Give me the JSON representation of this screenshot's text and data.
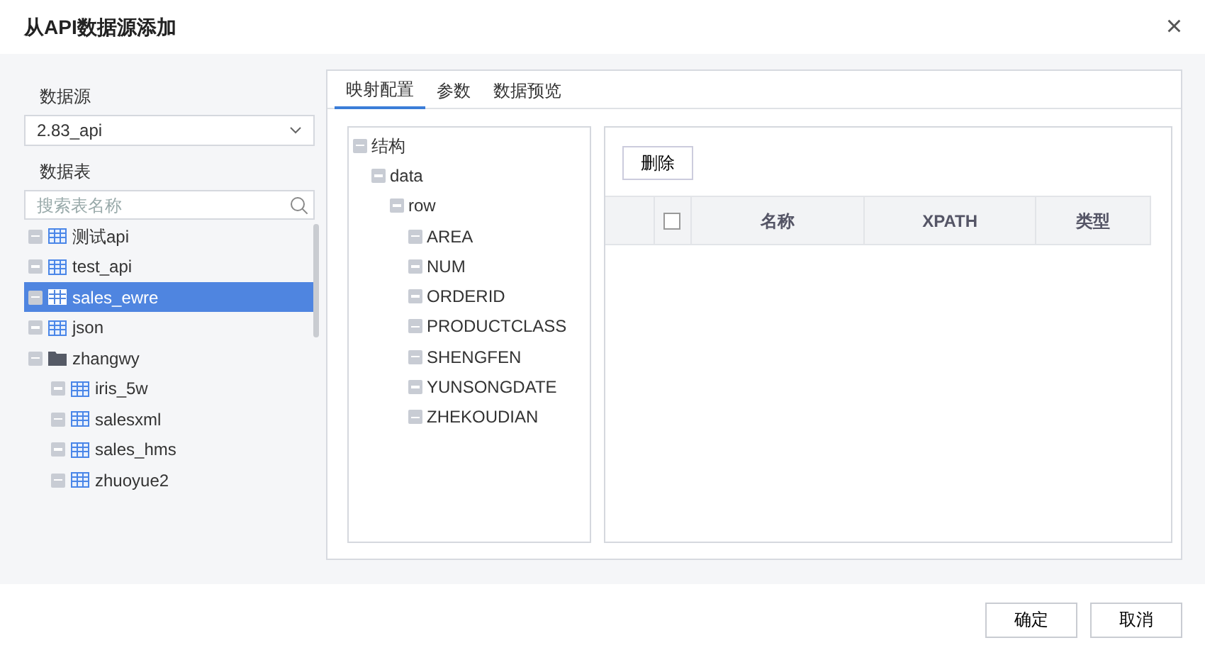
{
  "window": {
    "title": "从API数据源添加",
    "close": "×"
  },
  "datasource": {
    "label": "数据源",
    "value": "2.83_api"
  },
  "tables": {
    "label": "数据表",
    "search_placeholder": "搜索表名称",
    "items": [
      {
        "kind": "table",
        "name": "测试api",
        "selected": false
      },
      {
        "kind": "table",
        "name": "test_api",
        "selected": false
      },
      {
        "kind": "table",
        "name": "sales_ewre",
        "selected": true
      },
      {
        "kind": "table",
        "name": "json",
        "selected": false
      },
      {
        "kind": "folder",
        "name": "zhangwy",
        "selected": false,
        "children": [
          {
            "kind": "table",
            "name": "iris_5w",
            "selected": false
          },
          {
            "kind": "table",
            "name": "salesxml",
            "selected": false
          },
          {
            "kind": "table",
            "name": "sales_hms",
            "selected": false
          },
          {
            "kind": "table",
            "name": "zhuoyue2",
            "selected": false
          }
        ]
      }
    ]
  },
  "tabs": [
    {
      "label": "映射配置",
      "selected": true
    },
    {
      "label": "参数",
      "selected": false
    },
    {
      "label": "数据预览",
      "selected": false
    }
  ],
  "structure": [
    {
      "name": "结构",
      "children": [
        {
          "name": "data",
          "children": [
            {
              "name": "row",
              "children": [
                {
                  "name": "AREA"
                },
                {
                  "name": "NUM"
                },
                {
                  "name": "ORDERID"
                },
                {
                  "name": "PRODUCTCLASS"
                },
                {
                  "name": "SHENGFEN"
                },
                {
                  "name": "YUNSONGDATE"
                },
                {
                  "name": "ZHEKOUDIAN"
                }
              ]
            }
          ]
        }
      ]
    }
  ],
  "delete_button": "删除",
  "mapping_table": {
    "select_all_checked": false,
    "columns": [
      "名称",
      "XPATH",
      "类型"
    ]
  },
  "buttons": [
    "确定",
    "取消"
  ]
}
